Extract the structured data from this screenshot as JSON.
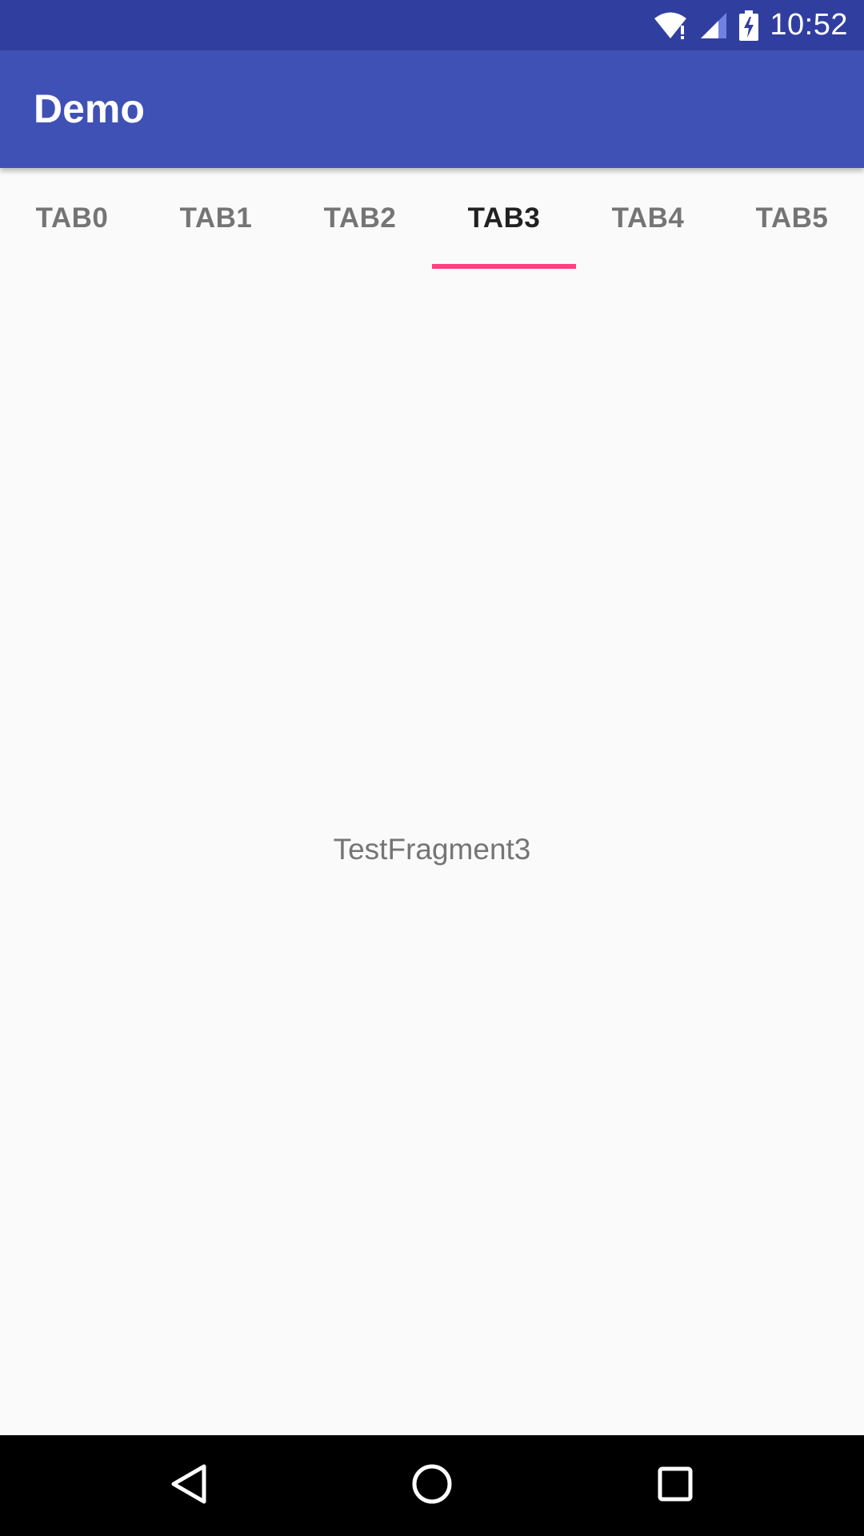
{
  "status_bar": {
    "time": "10:52",
    "icons": [
      "wifi-alert-icon",
      "cellular-signal-icon",
      "battery-charging-icon"
    ]
  },
  "app_bar": {
    "title": "Demo"
  },
  "tabs": {
    "items": [
      {
        "label": "TAB0"
      },
      {
        "label": "TAB1"
      },
      {
        "label": "TAB2"
      },
      {
        "label": "TAB3"
      },
      {
        "label": "TAB4"
      },
      {
        "label": "TAB5"
      }
    ],
    "selected_label": "TAB3"
  },
  "content": {
    "fragment_text": "TestFragment3"
  },
  "nav_bar": {
    "buttons": [
      "back-icon",
      "home-icon",
      "recents-icon"
    ]
  },
  "colors": {
    "status_bar": "#303F9F",
    "app_bar": "#3F51B5",
    "tab_indicator": "#FF4081",
    "background": "#FAFAFA",
    "tab_text": "#757575",
    "tab_text_selected": "#212121"
  }
}
